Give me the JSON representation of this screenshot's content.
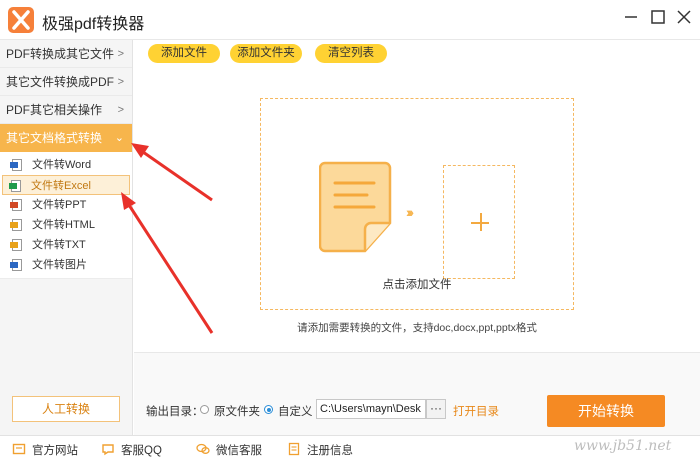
{
  "app": {
    "title": "极强pdf转换器"
  },
  "sidebar": {
    "menus": [
      {
        "label": "PDF转换成其它文件",
        "chevron": ">"
      },
      {
        "label": "其它文件转换成PDF",
        "chevron": ">"
      },
      {
        "label": "PDF其它相关操作",
        "chevron": ">"
      },
      {
        "label": "其它文档格式转换",
        "chevron": "⌄"
      }
    ],
    "sub_items": [
      {
        "label": "文件转Word",
        "color": "#2b67c2"
      },
      {
        "label": "文件转Excel",
        "color": "#1f9a4b"
      },
      {
        "label": "文件转PPT",
        "color": "#d24a26"
      },
      {
        "label": "文件转HTML",
        "color": "#e8a21b"
      },
      {
        "label": "文件转TXT",
        "color": "#e8a21b"
      },
      {
        "label": "文件转图片",
        "color": "#2b67c2"
      }
    ],
    "manual_button": "人工转换"
  },
  "toolbar": {
    "add_file": "添加文件",
    "add_folder": "添加文件夹",
    "clear_list": "清空列表"
  },
  "dropzone": {
    "label": "点击添加文件",
    "hint": "请添加需要转换的文件，支持doc,docx,ppt,pptx格式"
  },
  "output": {
    "label": "输出目录：",
    "option_original": "原文件夹",
    "option_custom": "自定义",
    "path_value": "C:\\Users\\mayn\\Desk",
    "browse": "···",
    "open_dir": "打开目录",
    "start": "开始转换"
  },
  "footer": {
    "website": "官方网站",
    "qq": "客服QQ",
    "wechat": "微信客服",
    "register": "注册信息"
  },
  "colors": {
    "accent": "#f58a23",
    "pill": "#ffd233",
    "active_menu": "#f7b54c",
    "annotation": "#e8312a"
  }
}
